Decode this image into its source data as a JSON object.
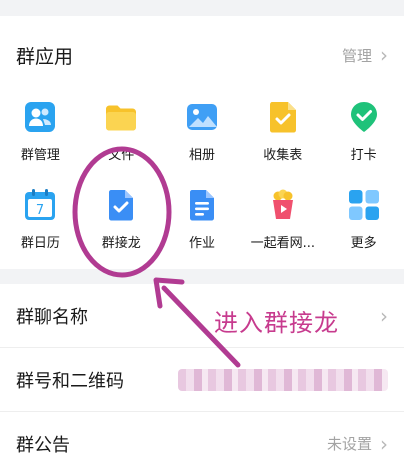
{
  "group_apps": {
    "title": "群应用",
    "manage_label": "管理",
    "items": [
      {
        "label": "群管理",
        "icon": "group-manage-icon"
      },
      {
        "label": "文件",
        "icon": "folder-icon"
      },
      {
        "label": "相册",
        "icon": "album-icon"
      },
      {
        "label": "收集表",
        "icon": "collect-form-icon"
      },
      {
        "label": "打卡",
        "icon": "checkin-icon"
      },
      {
        "label": "群日历",
        "icon": "calendar-icon"
      },
      {
        "label": "群接龙",
        "icon": "solitaire-icon"
      },
      {
        "label": "作业",
        "icon": "homework-icon"
      },
      {
        "label": "一起看网...",
        "icon": "watch-together-icon"
      },
      {
        "label": "更多",
        "icon": "more-apps-icon"
      }
    ]
  },
  "rows": {
    "group_name": {
      "title": "群聊名称"
    },
    "group_id_qr": {
      "title": "群号和二维码"
    },
    "announcement": {
      "title": "群公告",
      "value": "未设置"
    }
  },
  "annotation": {
    "text": "进入群接龙",
    "color": "#c73b8e"
  },
  "colors": {
    "accent_blue": "#2f8cf6",
    "yellow": "#f7c22b",
    "green": "#1fc27a",
    "pink_red": "#f0506e"
  },
  "calendar_day": "7"
}
